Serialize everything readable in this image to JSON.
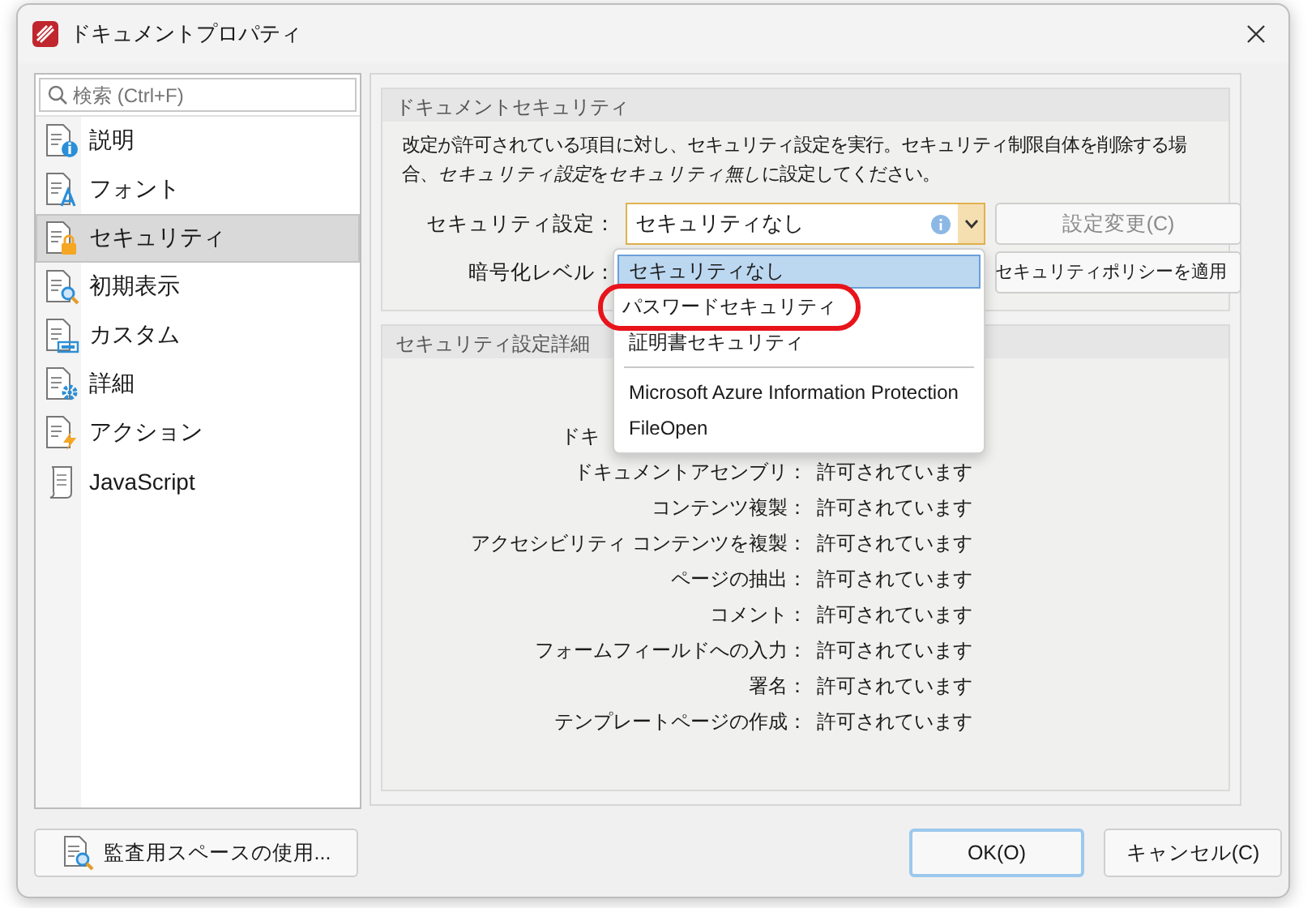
{
  "window": {
    "title": "ドキュメントプロパティ"
  },
  "sidebar": {
    "search_placeholder": "検索 (Ctrl+F)",
    "items": [
      {
        "label": "説明",
        "kind": "info",
        "selected": false
      },
      {
        "label": "フォント",
        "kind": "font",
        "selected": false
      },
      {
        "label": "セキュリティ",
        "kind": "lock",
        "selected": true
      },
      {
        "label": "初期表示",
        "kind": "view",
        "selected": false
      },
      {
        "label": "カスタム",
        "kind": "custom",
        "selected": false
      },
      {
        "label": "詳細",
        "kind": "gear",
        "selected": false
      },
      {
        "label": "アクション",
        "kind": "action",
        "selected": false
      },
      {
        "label": "JavaScript",
        "kind": "script",
        "selected": false
      }
    ]
  },
  "document_security": {
    "title": "ドキュメントセキュリティ",
    "description": [
      {
        "text": "改定が許可されている項目に対し、セキュリティ設定を実行。セキュリティ制限自体を削除する場合、",
        "italic": false
      },
      {
        "text": "セキュリティ設定",
        "italic": true
      },
      {
        "text": "を",
        "italic": false
      },
      {
        "text": "セキュリティ無し",
        "italic": true
      },
      {
        "text": "に設定してください。",
        "italic": false
      }
    ],
    "security_label": "セキュリティ設定：",
    "security_value": "セキュリティなし",
    "change_button": {
      "label": "設定変更(C)",
      "disabled": true
    },
    "encryption_label": "暗号化レベル：",
    "policy_button": "セキュリティポリシーを適用"
  },
  "dropdown": {
    "options": [
      {
        "label": "セキュリティなし",
        "selected": true,
        "circled": false,
        "separator_before": false
      },
      {
        "label": "パスワードセキュリティ",
        "selected": false,
        "circled": true,
        "separator_before": false
      },
      {
        "label": "証明書セキュリティ",
        "selected": false,
        "circled": false,
        "separator_before": false
      },
      {
        "label": "Microsoft Azure Information Protection",
        "selected": false,
        "circled": false,
        "separator_before": true
      },
      {
        "label": "FileOpen",
        "selected": false,
        "circled": false,
        "separator_before": false
      }
    ]
  },
  "details": {
    "title": "セキュリティ設定詳細",
    "rows": [
      {
        "label": "ドキ",
        "kind": "partial"
      },
      {
        "label": "ドキュメントアセンブリ：",
        "value": "許可されています",
        "kind": "full"
      },
      {
        "label": "コンテンツ複製：",
        "value": "許可されています",
        "kind": "full"
      },
      {
        "label": "アクセシビリティ コンテンツを複製：",
        "value": "許可されています",
        "kind": "full"
      },
      {
        "label": "ページの抽出：",
        "value": "許可されています",
        "kind": "full"
      },
      {
        "label": "コメント：",
        "value": "許可されています",
        "kind": "full"
      },
      {
        "label": "フォームフィールドへの入力：",
        "value": "許可されています",
        "kind": "full"
      },
      {
        "label": "署名：",
        "value": "許可されています",
        "kind": "full"
      },
      {
        "label": "テンプレートページの作成：",
        "value": "許可されています",
        "kind": "full"
      }
    ]
  },
  "footer": {
    "audit_button": "監査用スペースの使用...",
    "ok_button": "OK(O)",
    "cancel_button": "キャンセル(C)"
  }
}
